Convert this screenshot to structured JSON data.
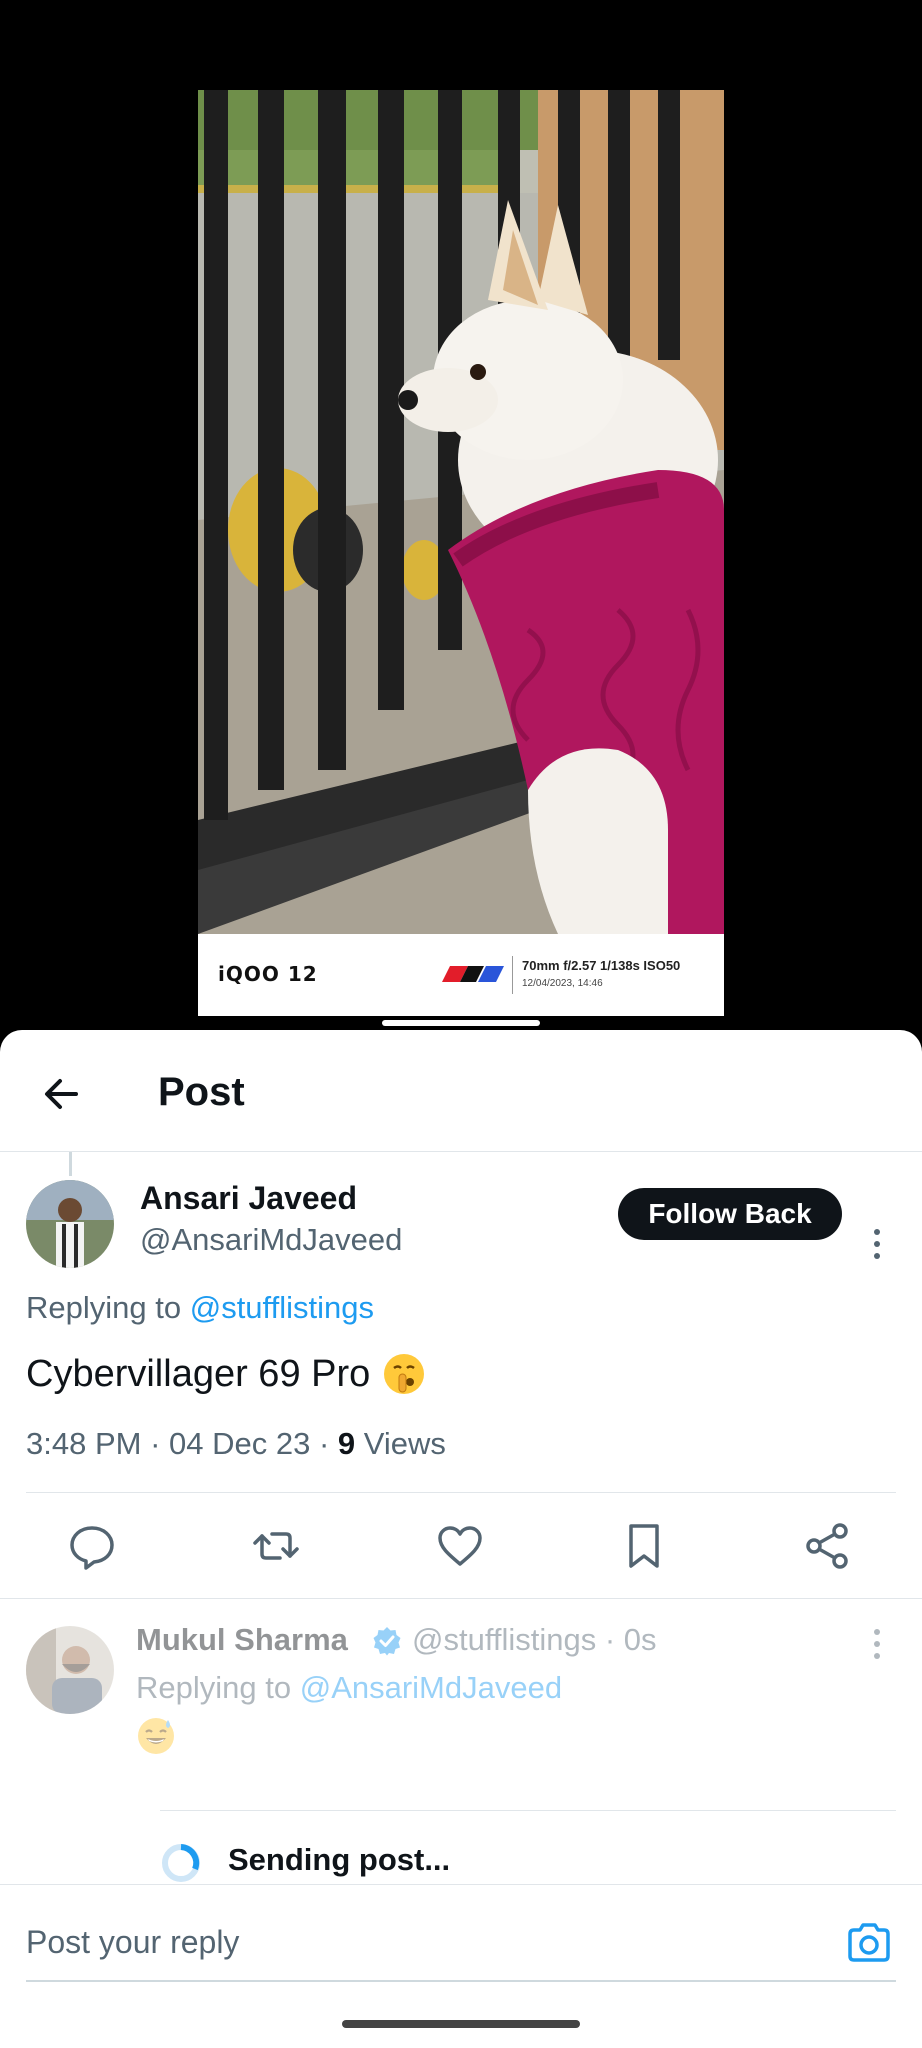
{
  "photo": {
    "watermark_brand": "iQOO 12",
    "watermark_specs": "70mm  f/2.57  1/138s  ISO50",
    "watermark_date": "12/04/2023, 14:46"
  },
  "header": {
    "back_icon": "arrow-left-icon",
    "title": "Post"
  },
  "post": {
    "author_name": "Ansari Javeed",
    "author_handle": "@AnsariMdJaveed",
    "follow_label": "Follow Back",
    "replying_prefix": "Replying to ",
    "replying_to": "@stufflistings",
    "text": "Cybervillager 69 Pro",
    "emoji": "shushing-face-emoji",
    "time": "3:48 PM",
    "date": "04 Dec 23",
    "views_count": "9",
    "views_label": "Views",
    "separator": " · "
  },
  "actions": [
    {
      "name": "reply",
      "icon": "comment-icon"
    },
    {
      "name": "repost",
      "icon": "repost-icon"
    },
    {
      "name": "like",
      "icon": "heart-icon"
    },
    {
      "name": "bookmark",
      "icon": "bookmark-icon"
    },
    {
      "name": "share",
      "icon": "share-icon"
    }
  ],
  "reply": {
    "author_name": "Mukul Sharma",
    "author_handle": "@stufflistings · 0s",
    "replying_prefix": "Replying to ",
    "replying_to": "@AnsariMdJaveed",
    "emoji": "grinning-sweat-emoji"
  },
  "sending": {
    "label": "Sending post..."
  },
  "composer": {
    "placeholder": "Post your reply",
    "camera_icon": "camera-icon"
  },
  "colors": {
    "accent": "#1d9bf0",
    "sweater": "#b0175e",
    "text_primary": "#0f1419",
    "text_secondary": "#536471"
  }
}
